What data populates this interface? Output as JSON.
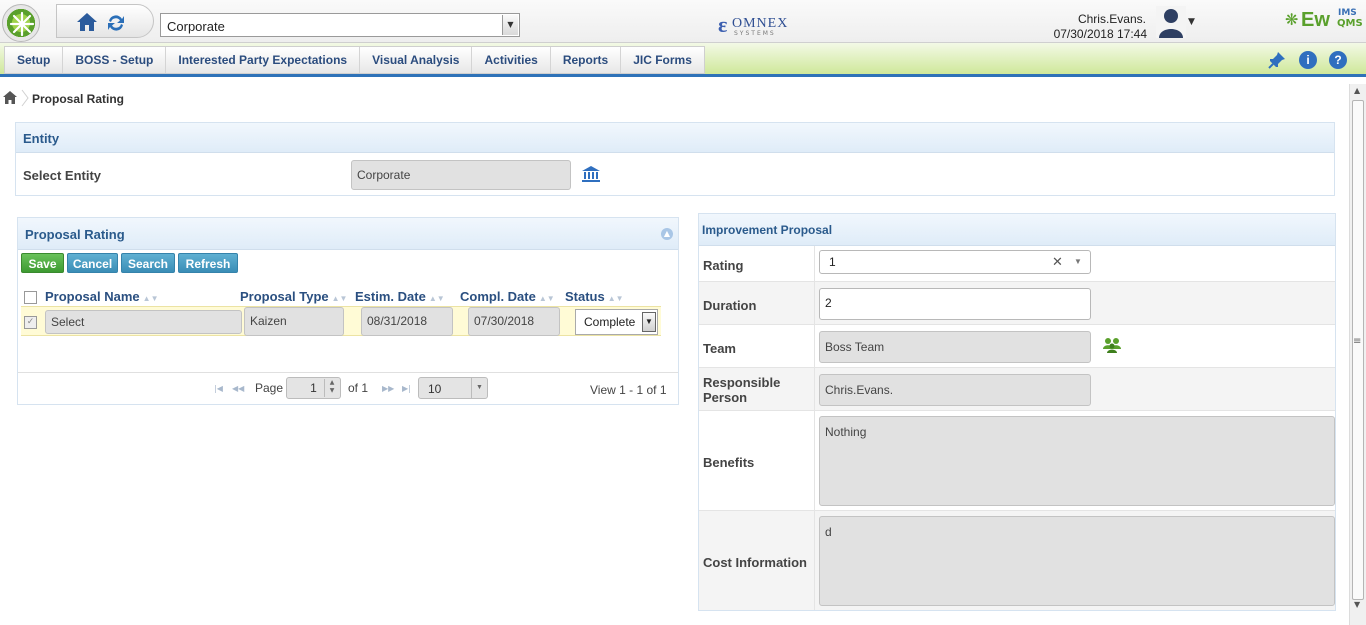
{
  "header": {
    "entity_selected": "Corporate",
    "user_name": "Chris.Evans.",
    "user_datetime": "07/30/2018 17:44",
    "company_logo": "OMNEX",
    "company_logo_sub": "SYSTEMS",
    "brand_ew": "Ew",
    "brand_ims": "IMS",
    "brand_qms": "QMS"
  },
  "nav": {
    "items": [
      "Setup",
      "BOSS - Setup",
      "Interested Party Expectations",
      "Visual Analysis",
      "Activities",
      "Reports",
      "JIC Forms"
    ],
    "icons": [
      "pin-icon",
      "info-icon",
      "help-icon"
    ]
  },
  "breadcrumb": {
    "current": "Proposal Rating"
  },
  "entity_panel": {
    "title": "Entity",
    "select_label": "Select Entity",
    "select_value": "Corporate"
  },
  "proposal_rating": {
    "title": "Proposal Rating",
    "buttons": {
      "save": "Save",
      "cancel": "Cancel",
      "search": "Search",
      "refresh": "Refresh"
    },
    "columns": [
      "Proposal Name",
      "Proposal Type",
      "Estim. Date",
      "Compl. Date",
      "Status"
    ],
    "rows": [
      {
        "proposal_name": "Select",
        "proposal_type": "Kaizen",
        "estim_date": "08/31/2018",
        "compl_date": "07/30/2018",
        "status": "Complete"
      }
    ],
    "pager": {
      "page_label": "Page",
      "page_value": "1",
      "of_label": "of 1",
      "rows_per_page": "10",
      "view_text": "View 1 - 1 of 1"
    }
  },
  "improvement_proposal": {
    "title": "Improvement Proposal",
    "fields": {
      "rating": {
        "label": "Rating",
        "value": "1"
      },
      "duration": {
        "label": "Duration",
        "value": "2"
      },
      "team": {
        "label": "Team",
        "value": "Boss Team"
      },
      "responsible_line1": "Responsible",
      "responsible_line2": "Person",
      "responsible_value": "Chris.Evans.",
      "benefits": {
        "label": "Benefits",
        "value": "Nothing"
      },
      "cost": {
        "label": "Cost Information",
        "value": "d"
      }
    }
  },
  "colors": {
    "nav_accent": "#2e72b8",
    "save_button": "#3d9a31",
    "action_button": "#3a8db6",
    "panel_title": "#2a5a8c"
  }
}
